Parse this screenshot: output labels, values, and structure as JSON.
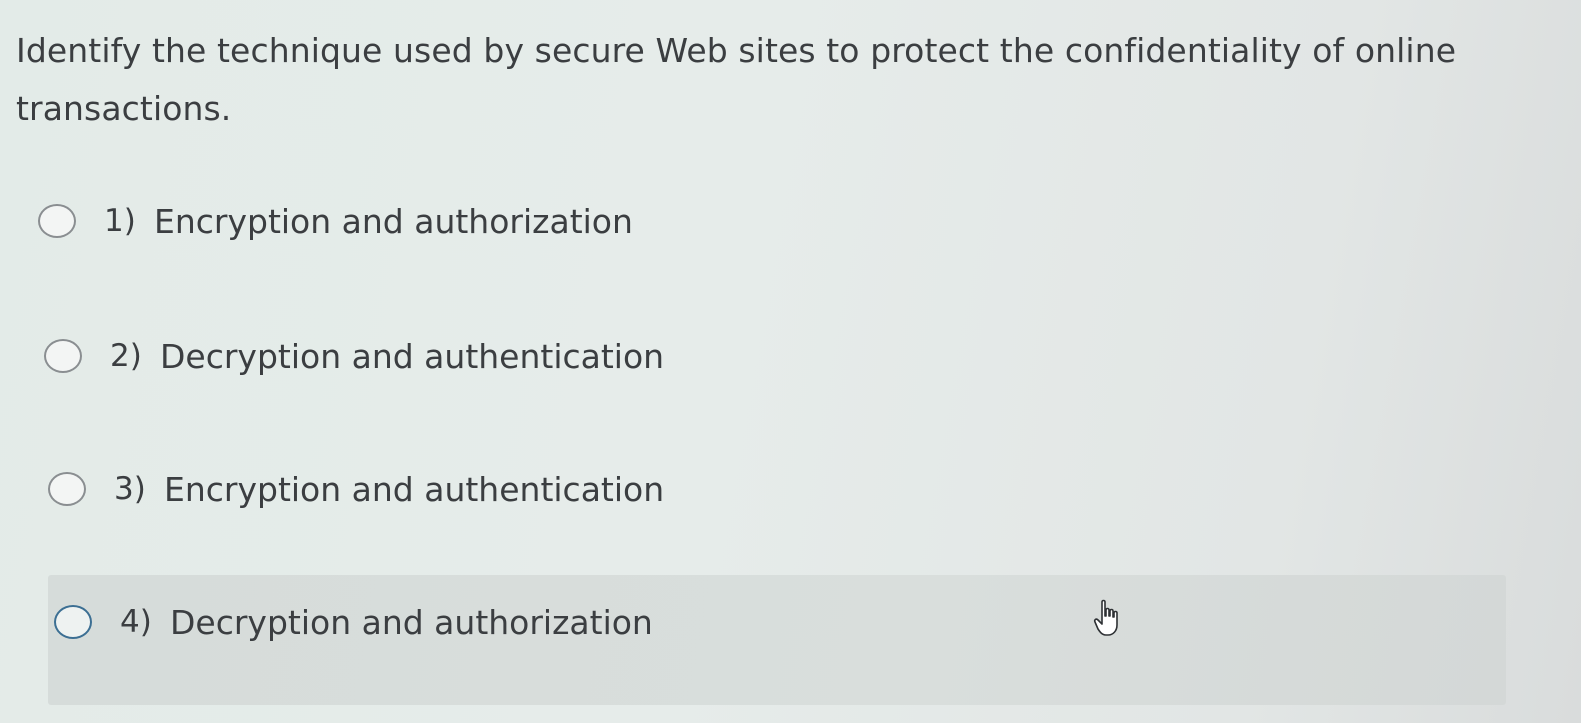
{
  "question": {
    "text": "Identify the technique used by secure Web sites to protect the confidentiality of online transactions."
  },
  "options": [
    {
      "number": "1)",
      "label": "Encryption and authorization"
    },
    {
      "number": "2)",
      "label": "Decryption and authentication"
    },
    {
      "number": "3)",
      "label": "Encryption and authentication"
    },
    {
      "number": "4)",
      "label": "Decryption and authorization"
    }
  ],
  "state": {
    "hovered_option": 4,
    "selected_option": null
  },
  "cursor": {
    "icon": "hand-pointer-icon"
  },
  "colors": {
    "text": "#3b3e41",
    "radio_border": "#8a8e91",
    "radio_hover_border": "#3c6f93",
    "hover_band": "#d8dddb"
  }
}
